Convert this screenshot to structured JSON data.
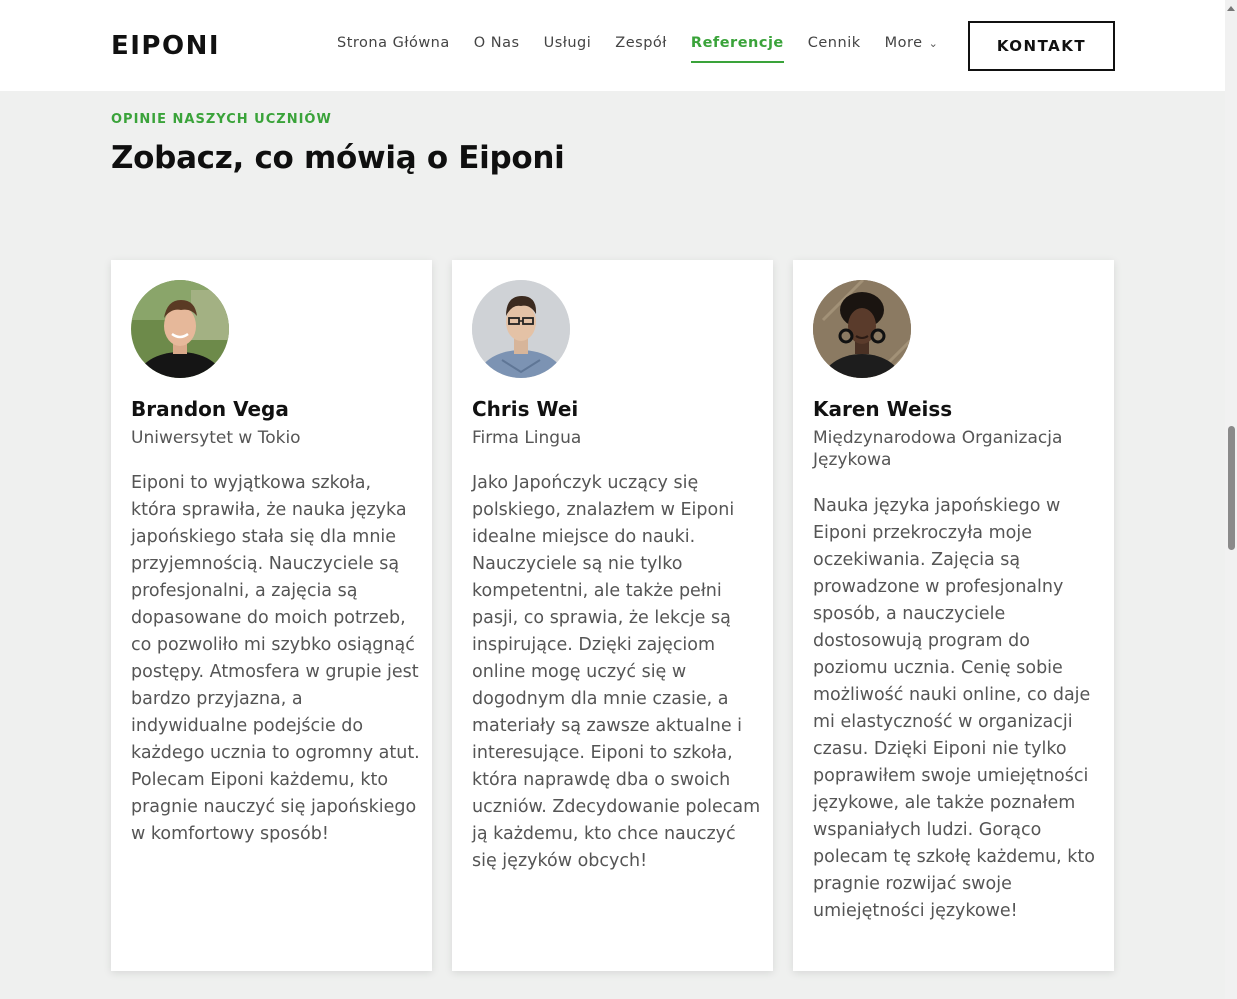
{
  "header": {
    "logo": "EIPONI",
    "nav": [
      {
        "label": "Strona Główna"
      },
      {
        "label": "O Nas"
      },
      {
        "label": "Usługi"
      },
      {
        "label": "Zespół"
      },
      {
        "label": "Referencje",
        "active": true
      },
      {
        "label": "Cennik"
      },
      {
        "label": "More",
        "dropdown": true
      }
    ],
    "cta_label": "KONTAKT"
  },
  "section": {
    "eyebrow": "OPINIE NASZYCH UCZNIÓW",
    "title": "Zobacz, co mówią o Eiponi"
  },
  "testimonials": [
    {
      "name": "Brandon Vega",
      "org": "Uniwersytet w Tokio",
      "quote": "Eiponi to wyjątkowa szkoła, która sprawiła, że nauka języka japońskiego stała się dla mnie przyjemnością. Nauczyciele są profesjonalni, a zajęcia są dopasowane do moich potrzeb, co pozwoliło mi szybko osiągnąć postępy. Atmosfera w grupie jest bardzo przyjazna, a indywidualne podejście do każdego ucznia to ogromny atut. Polecam Eiponi każdemu, kto pragnie nauczyć się japońskiego w komfortowy sposób!"
    },
    {
      "name": "Chris Wei",
      "org": "Firma Lingua",
      "quote": "Jako Japończyk uczący się polskiego, znalazłem w Eiponi idealne miejsce do nauki. Nauczyciele są nie tylko kompetentni, ale także pełni pasji, co sprawia, że lekcje są inspirujące. Dzięki zajęciom online mogę uczyć się w dogodnym dla mnie czasie, a materiały są zawsze aktualne i interesujące. Eiponi to szkoła, która naprawdę dba o swoich uczniów. Zdecydowanie polecam ją każdemu, kto chce nauczyć się języków obcych!"
    },
    {
      "name": "Karen Weiss",
      "org": "Międzynarodowa Organizacja Językowa",
      "quote": "Nauka języka japońskiego w Eiponi przekroczyła moje oczekiwania. Zajęcia są prowadzone w profesjonalny sposób, a nauczyciele dostosowują program do poziomu ucznia. Cenię sobie możliwość nauki online, co daje mi elastyczność w organizacji czasu. Dzięki Eiponi nie tylko poprawiłem swoje umiejętności językowe, ale także poznałem wspaniałych ludzi. Gorąco polecam tę szkołę każdemu, kto pragnie rozwijać swoje umiejętności językowe!"
    }
  ],
  "colors": {
    "accent": "#3aa33a",
    "background": "#eff0ef",
    "card": "#ffffff"
  }
}
